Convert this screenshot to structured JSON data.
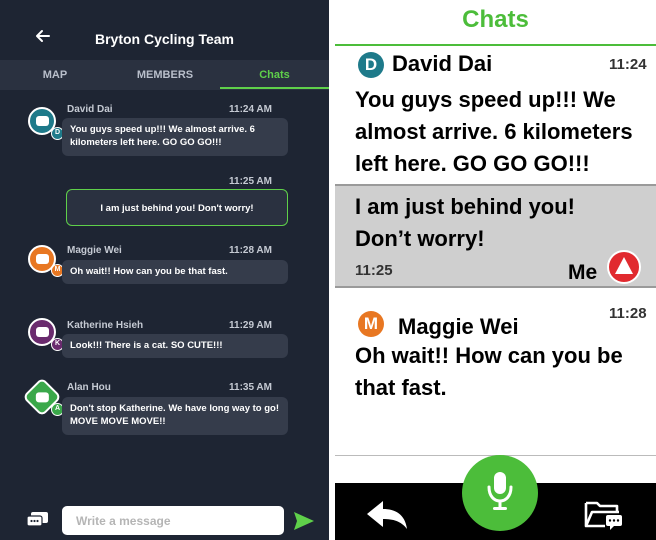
{
  "phone": {
    "title": "Bryton Cycling Team",
    "tabs": [
      "MAP",
      "MEMBERS",
      "Chats"
    ],
    "active_tab": "Chats",
    "messages": [
      {
        "sender": "David Dai",
        "initial": "D",
        "time": "11:24 AM",
        "text": "You guys speed up!!! We almost arrive. 6 kilometers left here. GO GO GO!!!",
        "color": "#1e7a8a"
      },
      {
        "mine": true,
        "time": "11:25 AM",
        "text": "I am just behind you! Don't worry!"
      },
      {
        "sender": "Maggie Wei",
        "initial": "M",
        "time": "11:28 AM",
        "text": "Oh wait!! How can you be that fast.",
        "color": "#e87722"
      },
      {
        "sender": "Katherine Hsieh",
        "initial": "K",
        "time": "11:29 AM",
        "text": "Look!!! There is a cat. SO CUTE!!!",
        "color": "#6a2b6e"
      },
      {
        "sender": "Alan Hou",
        "initial": "A",
        "time": "11:35 AM",
        "text": "Don't stop Katherine. We have long way to go! MOVE MOVE MOVE!!",
        "color": "#3aa84a"
      }
    ],
    "composer": {
      "placeholder": "Write a message"
    }
  },
  "device": {
    "title": "Chats",
    "messages": [
      {
        "initial": "D",
        "sender": "David Dai",
        "time": "11:24",
        "lines": [
          "You guys speed up!!! We",
          "almost arrive. 6 kilometers",
          "left here. GO GO GO!!!"
        ],
        "color": "#1e7a8a"
      },
      {
        "mine": true,
        "lines": [
          "I am just behind you!",
          "Don’t worry!"
        ],
        "time": "11:25",
        "me_label": "Me"
      },
      {
        "initial": "M",
        "sender": "Maggie Wei",
        "time": "11:28",
        "lines": [
          "Oh wait!! How can you be",
          "that fast."
        ],
        "color": "#e87722"
      }
    ],
    "bottom_bar": {
      "icons": [
        "reply-icon",
        "microphone-icon",
        "folder-message-icon"
      ]
    }
  },
  "colors": {
    "phone_bg": "#1e2533",
    "accent_green": "#5fd04a",
    "device_green": "#4cbd3a",
    "me_red": "#e12a2f"
  }
}
